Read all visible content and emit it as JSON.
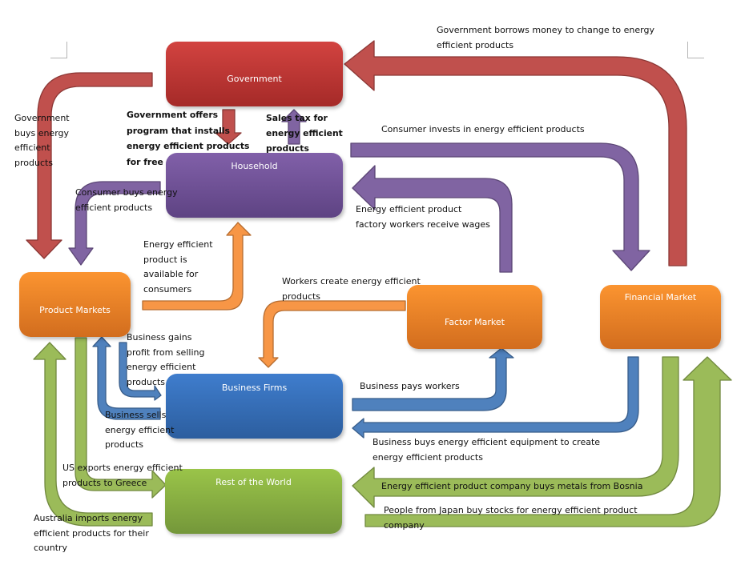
{
  "colors": {
    "government": "#c0504d",
    "household": "#8064a2",
    "market": "#f79646",
    "business": "#4f81bd",
    "world": "#9bbb59"
  },
  "nodes": {
    "government": "Government",
    "household": "Household",
    "product_markets": "Product Markets",
    "factor_market": "Factor Market",
    "financial_market": "Financial Market",
    "business_firms": "Business Firms",
    "rest_of_world": "Rest of the World"
  },
  "labels": {
    "gov_borrows": "Government borrows money to change to energy efficient products",
    "gov_buys": "Government buys energy efficient products",
    "gov_offers": "Government offers program that installs energy efficient products for free",
    "sales_tax": "Sales tax for energy efficient products",
    "consumer_invests": "Consumer invests in energy efficient products",
    "consumer_buys": "Consumer buys energy efficient products",
    "factory_wages": "Energy efficient product factory workers receive wages",
    "product_available": "Energy efficient product is available for consumers",
    "workers_create": "Workers create energy efficient products",
    "business_gains": "Business gains profit from selling energy efficient products",
    "business_pays": "Business pays workers",
    "business_sells": "Business sells energy efficient products",
    "business_buys_equipment": "Business buys energy efficient equipment to create energy efficient products",
    "us_exports": "US exports energy efficient products to Greece",
    "buys_metals": "Energy efficient product company buys metals from Bosnia",
    "japan_stocks": "People from Japan buy stocks for energy efficient product company",
    "australia_imports": "Australia imports energy efficient products for their country"
  }
}
